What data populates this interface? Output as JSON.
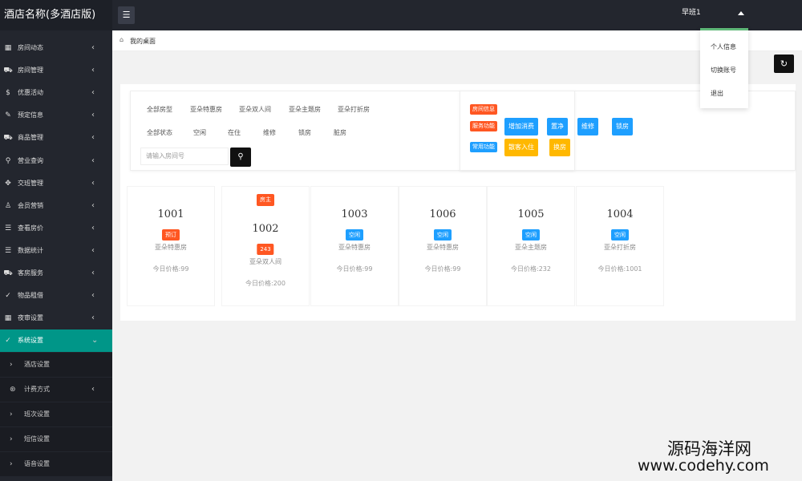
{
  "app": {
    "brand": "酒店名称(多酒店版)",
    "user": "早班1"
  },
  "menu_icon": "hamburger-icon",
  "dropdown": [
    "个人信息",
    "切换账号",
    "退出"
  ],
  "sidebar": {
    "items": [
      {
        "label": "房间动态",
        "icon": "▦",
        "chevron": "‹"
      },
      {
        "label": "房间管理",
        "icon": "⛟",
        "chevron": "‹"
      },
      {
        "label": "优惠活动",
        "icon": "$",
        "chevron": "‹"
      },
      {
        "label": "预定信息",
        "icon": "✎",
        "chevron": "‹"
      },
      {
        "label": "商品管理",
        "icon": "⛟",
        "chevron": "‹"
      },
      {
        "label": "营业查询",
        "icon": "⚲",
        "chevron": "‹"
      },
      {
        "label": "交班管理",
        "icon": "✥",
        "chevron": "‹"
      },
      {
        "label": "会员营销",
        "icon": "♙",
        "chevron": "‹"
      },
      {
        "label": "查看房价",
        "icon": "☰",
        "chevron": "‹"
      },
      {
        "label": "数据统计",
        "icon": "☰",
        "chevron": "‹"
      },
      {
        "label": "客房服务",
        "icon": "⛟",
        "chevron": "‹"
      },
      {
        "label": "物品租借",
        "icon": "✓",
        "chevron": "‹"
      },
      {
        "label": "夜审设置",
        "icon": "▦",
        "chevron": "‹"
      },
      {
        "label": "系统设置",
        "icon": "✓",
        "chevron": "⌄"
      }
    ],
    "sub_items": [
      {
        "label": "酒店设置",
        "icon": "›",
        "chevron": ""
      },
      {
        "label": "计费方式",
        "icon": "⊛",
        "chevron": "‹"
      },
      {
        "label": "班次设置",
        "icon": "›",
        "chevron": ""
      },
      {
        "label": "短信设置",
        "icon": "›",
        "chevron": ""
      },
      {
        "label": "语音设置",
        "icon": "›",
        "chevron": ""
      }
    ]
  },
  "breadcrumb": {
    "home_icon": "⌂",
    "label": "我的桌面"
  },
  "refresh_icon": "↻",
  "filters": {
    "room_types": [
      "全部房型",
      "亚朵特惠房",
      "亚朵双人间",
      "亚朵主题房",
      "亚朵打折房"
    ],
    "states": [
      "全部状态",
      "空闲",
      "在住",
      "维修",
      "锁房",
      "脏房"
    ],
    "search_placeholder": "请输入房间号",
    "search_icon": "🔍"
  },
  "functions": {
    "room_info_tag": "房间信息",
    "service_tag": "服务功能",
    "common_tag": "常用功能",
    "service_buttons": [
      "增加消费",
      "置净",
      "维修",
      "锁房"
    ],
    "common_buttons": [
      "散客入住",
      "换房"
    ]
  },
  "rooms": [
    {
      "number": "1001",
      "status": "预订",
      "status_color": "#ff5722",
      "type": "亚朵特惠房",
      "price": "今日价格:99",
      "host": ""
    },
    {
      "number": "1002",
      "status": "243",
      "status_color": "#ff5722",
      "type": "亚朵双人间",
      "price": "今日价格:200",
      "host": "房主"
    },
    {
      "number": "1003",
      "status": "空闲",
      "status_color": "#1e9fff",
      "type": "亚朵特惠房",
      "price": "今日价格:99",
      "host": ""
    },
    {
      "number": "1006",
      "status": "空闲",
      "status_color": "#1e9fff",
      "type": "亚朵特惠房",
      "price": "今日价格:99",
      "host": ""
    },
    {
      "number": "1005",
      "status": "空闲",
      "status_color": "#1e9fff",
      "type": "亚朵主题房",
      "price": "今日价格:232",
      "host": ""
    },
    {
      "number": "1004",
      "status": "空闲",
      "status_color": "#1e9fff",
      "type": "亚朵打折房",
      "price": "今日价格:1001",
      "host": ""
    }
  ],
  "watermark": {
    "line1": "源码海洋网",
    "line2": "www.codehy.com"
  }
}
